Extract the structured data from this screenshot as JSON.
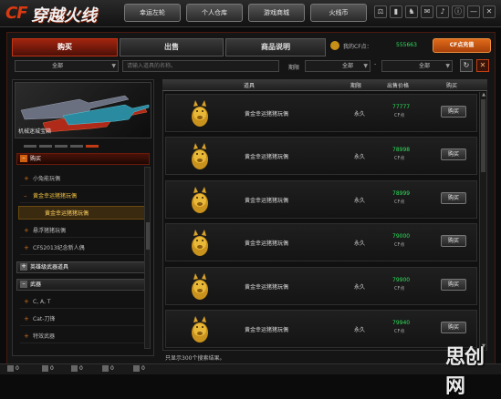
{
  "app": {
    "logo_cf": "CF",
    "logo_name": "穿越火线",
    "logo_sub": ""
  },
  "topnav": [
    {
      "label": "幸运左轮"
    },
    {
      "label": "个人仓库"
    },
    {
      "label": "游戏商城"
    },
    {
      "label": "火线币"
    }
  ],
  "window_icons": [
    "⚖",
    "▮",
    "♞",
    "✉",
    "♪",
    "ⓘ",
    "—",
    "✕"
  ],
  "tabs": [
    {
      "label": "购买"
    },
    {
      "label": "出售"
    },
    {
      "label": "商品说明"
    }
  ],
  "cf_points": {
    "label": "我的CF点：",
    "value": "555663"
  },
  "recharge_label": "CF点充值",
  "filter": {
    "category": "全部",
    "search_placeholder": "请输入道具的名称。",
    "period_label": "期限",
    "period_from": "全部",
    "dash": "-",
    "period_to": "全部",
    "search_icon": "↻",
    "close_icon": "✕"
  },
  "sidebar": {
    "banner_title": "机械迷城宝箱",
    "cat_buy": "购买",
    "items": [
      {
        "label": "小兔能玩偶"
      },
      {
        "label": "黄金幸运猪猪玩偶"
      },
      {
        "label": "黄金幸运猪猪玩偶"
      },
      {
        "label": "悬浮猪猪玩偶"
      },
      {
        "label": "CFS2013纪念新人偶"
      }
    ],
    "cat_hero": "英雄级武器道具",
    "cat_weapon": "武器",
    "weapon_items": [
      {
        "label": "C, A, T"
      },
      {
        "label": "Cat-刀锋"
      },
      {
        "label": "特效武器"
      }
    ]
  },
  "table": {
    "headers": {
      "item": "道具",
      "period": "期限",
      "price": "出售价格",
      "buy": "购买"
    },
    "rows": [
      {
        "name": "黄金幸运猪猪玩偶",
        "period": "永久",
        "price": "77777",
        "unit": "CF点",
        "buy": "购买"
      },
      {
        "name": "黄金幸运猪猪玩偶",
        "period": "永久",
        "price": "78998",
        "unit": "CF点",
        "buy": "购买"
      },
      {
        "name": "黄金幸运猪猪玩偶",
        "period": "永久",
        "price": "78999",
        "unit": "CF点",
        "buy": "购买"
      },
      {
        "name": "黄金幸运猪猪玩偶",
        "period": "永久",
        "price": "79000",
        "unit": "CF点",
        "buy": "购买"
      },
      {
        "name": "黄金幸运猪猪玩偶",
        "period": "永久",
        "price": "79900",
        "unit": "CF点",
        "buy": "购买"
      },
      {
        "name": "黄金幸运猪猪玩偶",
        "period": "永久",
        "price": "79940",
        "unit": "CF点",
        "buy": "购买"
      }
    ]
  },
  "status_text": "只显示300个搜索结果。",
  "bottom_bar": [
    {
      "label": "0"
    },
    {
      "label": "0"
    },
    {
      "label": "0"
    },
    {
      "label": "0"
    },
    {
      "label": "0"
    }
  ],
  "watermark": "思创网"
}
